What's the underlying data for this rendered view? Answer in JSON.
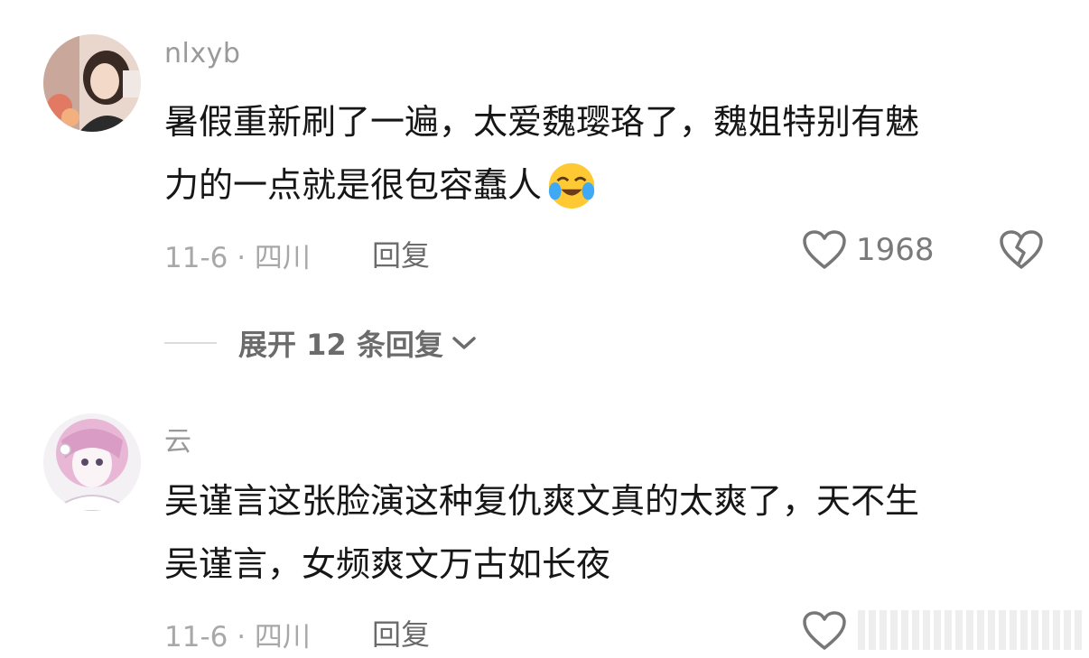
{
  "comments": [
    {
      "username": "nlxyb",
      "text_line1": "暑假重新刷了一遍，太爱魏璎珞了，魏姐特别有魅",
      "text_line2": "力的一点就是很包容蠢人",
      "emoji": "crying-laughing-emoji",
      "date_location": "11-6 · 四川",
      "reply_label": "回复",
      "like_count": "1968"
    },
    {
      "username": "云",
      "text_line1": "吴谨言这张脸演这种复仇爽文真的太爽了，天不生",
      "text_line2": "吴谨言，女频爽文万古如长夜",
      "date_location": "11-6 · 四川",
      "reply_label": "回复"
    }
  ],
  "expand_replies": {
    "label": "展开 12 条回复"
  },
  "icons": {
    "like": "heart-outline-icon",
    "dislike": "broken-heart-icon",
    "expand": "chevron-down-icon"
  },
  "colors": {
    "text": "#161616",
    "meta": "#a8a8a8",
    "username": "#9a9a9a"
  }
}
